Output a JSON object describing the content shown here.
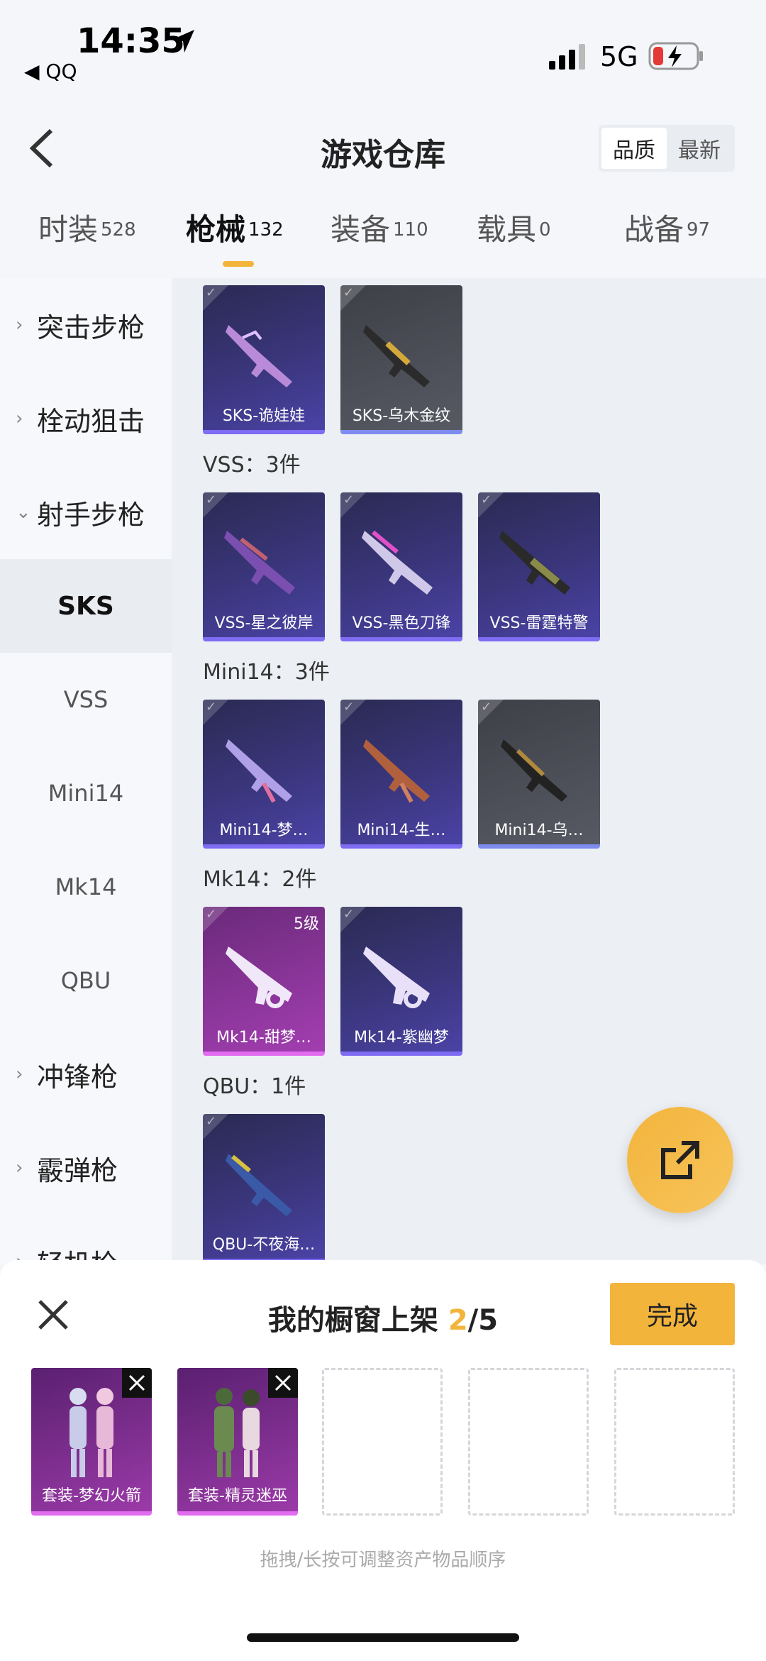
{
  "status_bar": {
    "time": "14:35",
    "back_app": "◀ QQ",
    "network": "5G"
  },
  "header": {
    "title": "游戏仓库",
    "sort": [
      "品质",
      "最新"
    ]
  },
  "tabs": [
    {
      "label": "时装",
      "count": "528"
    },
    {
      "label": "枪械",
      "count": "132"
    },
    {
      "label": "装备",
      "count": "110"
    },
    {
      "label": "载具",
      "count": "0"
    },
    {
      "label": "战备",
      "count": "97"
    }
  ],
  "sidebar": {
    "items": [
      {
        "label": "突击步枪",
        "kind": "category",
        "chevron": "›"
      },
      {
        "label": "栓动狙击",
        "kind": "category",
        "chevron": "›"
      },
      {
        "label": "射手步枪",
        "kind": "category",
        "chevron": "⌄"
      },
      {
        "label": "SKS",
        "kind": "sub",
        "active": true
      },
      {
        "label": "VSS",
        "kind": "sub"
      },
      {
        "label": "Mini14",
        "kind": "sub"
      },
      {
        "label": "Mk14",
        "kind": "sub"
      },
      {
        "label": "QBU",
        "kind": "sub"
      },
      {
        "label": "冲锋枪",
        "kind": "category",
        "chevron": "›"
      },
      {
        "label": "霰弹枪",
        "kind": "category",
        "chevron": "›"
      },
      {
        "label": "轻机枪",
        "kind": "category",
        "chevron": "›"
      }
    ]
  },
  "groups": [
    {
      "label": "",
      "items": [
        {
          "name": "SKS-诡娃娃",
          "rarity": "purple"
        },
        {
          "name": "SKS-乌木金纹",
          "rarity": "gray"
        }
      ]
    },
    {
      "label": "VSS：3件",
      "items": [
        {
          "name": "VSS-星之彼岸",
          "rarity": "purple"
        },
        {
          "name": "VSS-黑色刀锋",
          "rarity": "purple"
        },
        {
          "name": "VSS-雷霆特警",
          "rarity": "purple"
        }
      ]
    },
    {
      "label": "Mini14：3件",
      "items": [
        {
          "name": "Mini14-梦…",
          "rarity": "purple"
        },
        {
          "name": "Mini14-生…",
          "rarity": "purple"
        },
        {
          "name": "Mini14-乌…",
          "rarity": "gray"
        }
      ]
    },
    {
      "label": "Mk14：2件",
      "items": [
        {
          "name": "Mk14-甜梦…",
          "rarity": "pink",
          "level": "5级"
        },
        {
          "name": "Mk14-紫幽梦",
          "rarity": "purple"
        }
      ]
    },
    {
      "label": "QBU：1件",
      "items": [
        {
          "name": "QBU-不夜海…",
          "rarity": "purple"
        }
      ]
    }
  ],
  "sheet": {
    "title_prefix": "我的橱窗上架 ",
    "current": "2",
    "separator": "/",
    "max": "5",
    "done_label": "完成",
    "slots": [
      {
        "name": "套装-梦幻火箭"
      },
      {
        "name": "套装-精灵迷巫"
      },
      {},
      {},
      {}
    ],
    "hint": "拖拽/长按可调整资产物品顺序"
  },
  "colors": {
    "accent": "#f3b43c",
    "purple_rarity": "#7e6cf3",
    "pink_rarity": "#e26cf0"
  }
}
